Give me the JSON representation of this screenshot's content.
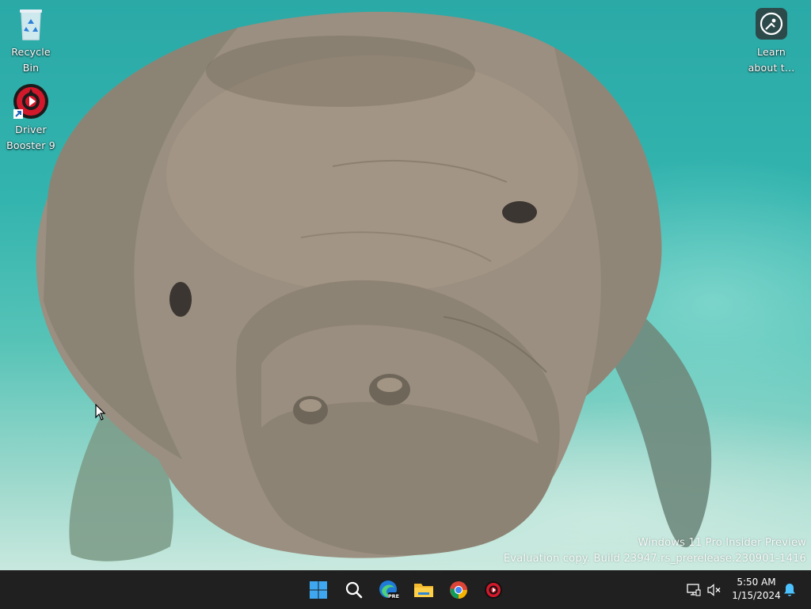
{
  "desktop": {
    "icons": [
      {
        "label": "Recycle\nBin",
        "icon": "recycle-bin-icon"
      },
      {
        "label": "Driver\nBooster 9",
        "icon": "driver-booster-icon"
      },
      {
        "label": "Learn\nabout t...",
        "icon": "learn-about-windows-icon"
      }
    ],
    "watermark": {
      "line1": "Windows 11 Pro Insider Preview",
      "line2": "Evaluation copy. Build 23947.rs_prerelease.230901-1416"
    }
  },
  "taskbar": {
    "apps": [
      "windows-start-icon",
      "search-icon",
      "edge-preview-icon",
      "file-explorer-icon",
      "chrome-icon",
      "driver-booster-icon"
    ],
    "edge_badge": "PRE",
    "tray": {
      "icons": [
        "network-icon",
        "volume-muted-icon",
        "notification-bell-icon"
      ],
      "time": "5:50 AM",
      "date": "1/15/2024"
    },
    "background": "#202020"
  }
}
